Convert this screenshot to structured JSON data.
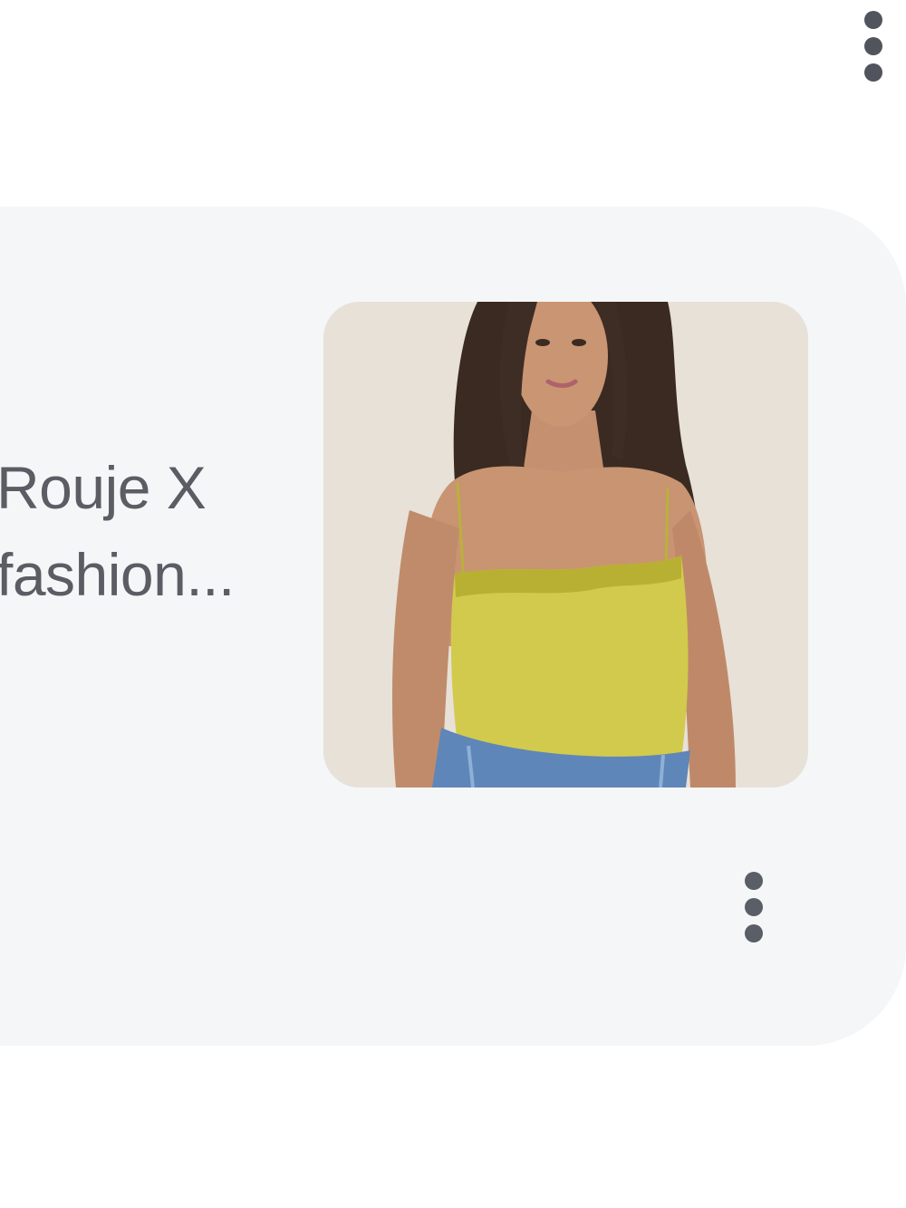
{
  "card": {
    "title": "Rouje X\nfashion...",
    "image_description_icon": "product-photo",
    "more_options_icon": "more-vert-icon"
  },
  "header": {
    "more_options_icon": "more-vert-icon"
  },
  "colors": {
    "card_background": "#f5f6f8",
    "title_text": "#5a5d63",
    "kebab_dots": "#50545c",
    "top_garment": "#cfc84a"
  }
}
